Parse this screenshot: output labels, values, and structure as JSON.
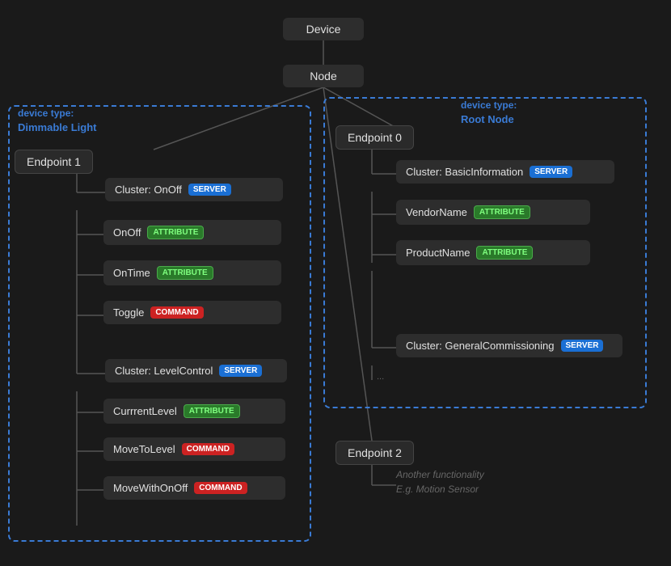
{
  "nodes": {
    "device": "Device",
    "node": "Node"
  },
  "endpoints": {
    "endpoint0": "Endpoint 0",
    "endpoint1": "Endpoint 1",
    "endpoint2": "Endpoint 2"
  },
  "deviceTypes": {
    "dimmableLight": {
      "line1": "device type:",
      "line2": "Dimmable Light"
    },
    "rootNode": {
      "line1": "device type:",
      "line2": "Root Node"
    }
  },
  "clusters": {
    "onoff": "Cluster: OnOff",
    "levelControl": "Cluster: LevelControl",
    "basicInformation": "Cluster: BasicInformation",
    "generalCommissioning": "Cluster: GeneralCommissioning"
  },
  "items": {
    "onoff_attr": "OnOff",
    "ontime_attr": "OnTime",
    "toggle_cmd": "Toggle",
    "currentLevel_attr": "CurrrentLevel",
    "moveToLevel_cmd": "MoveToLevel",
    "moveWithOnOff_cmd": "MoveWithOnOff",
    "vendorName_attr": "VendorName",
    "productName_attr": "ProductName"
  },
  "badges": {
    "server": "SERVER",
    "attribute": "ATTRIBUTE",
    "command": "COMMAND"
  },
  "more": "...",
  "functionality": {
    "line1": "Another functionality",
    "line2": "E.g. Motion Sensor"
  }
}
